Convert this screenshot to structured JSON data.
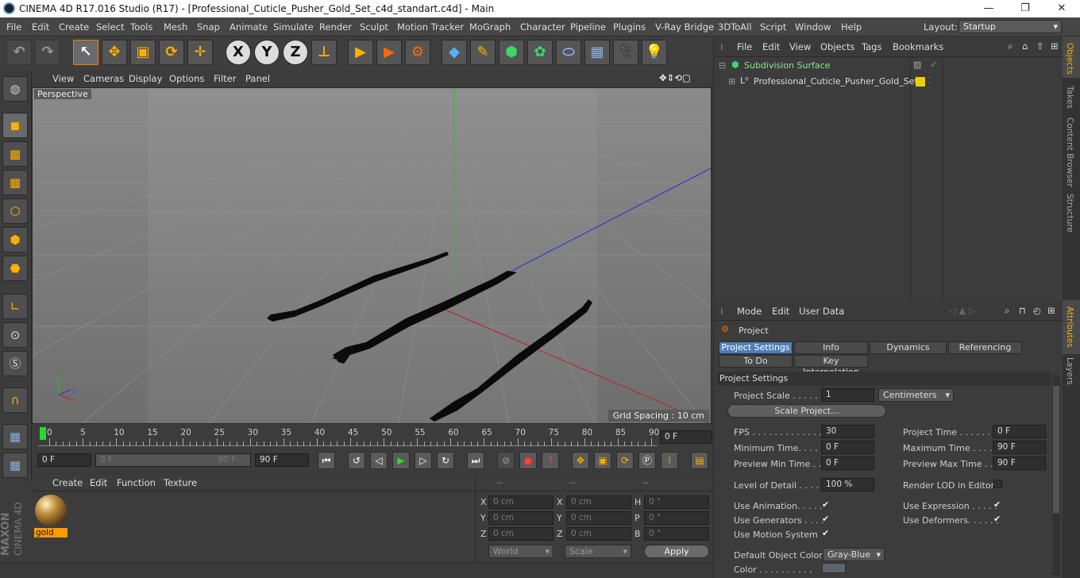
{
  "titlebar": {
    "title": "CINEMA 4D R17.016 Studio (R17) - [Professional_Cuticle_Pusher_Gold_Set_c4d_standart.c4d] - Main",
    "minimize": "—",
    "maximize": "❐",
    "close": "✕"
  },
  "menu": [
    "File",
    "Edit",
    "Create",
    "Select",
    "Tools",
    "Mesh",
    "Snap",
    "Animate",
    "Simulate",
    "Render",
    "Sculpt",
    "Motion Tracker",
    "MoGraph",
    "Character",
    "Pipeline",
    "Plugins",
    "V-Ray Bridge",
    "3DToAll",
    "Script",
    "Window",
    "Help"
  ],
  "layout": {
    "label": "Layout:",
    "value": "Startup"
  },
  "toolbar": {
    "x": "X",
    "y": "Y",
    "z": "Z"
  },
  "viewport": {
    "menu": [
      "View",
      "Cameras",
      "Display",
      "Options",
      "Filter",
      "Panel"
    ],
    "label": "Perspective",
    "grid_spacing": "Grid Spacing : 10 cm",
    "axis_labels": {
      "x": "X",
      "y": "Y",
      "z": "Z"
    }
  },
  "timeline": {
    "ticks": [
      "0",
      "5",
      "10",
      "15",
      "20",
      "25",
      "30",
      "35",
      "40",
      "45",
      "50",
      "55",
      "60",
      "65",
      "70",
      "75",
      "80",
      "85",
      "90"
    ],
    "current_frame": "0 F",
    "start": "0 F",
    "range_start": "0 F",
    "range_end": "90 F",
    "end": "90 F"
  },
  "material_panel": {
    "menu": [
      "Create",
      "Edit",
      "Function",
      "Texture"
    ],
    "materials": [
      {
        "name": "gold"
      }
    ]
  },
  "coords": {
    "headers": [
      "--",
      "--",
      "--"
    ],
    "rows": [
      {
        "a": "X",
        "av": "0 cm",
        "b": "X",
        "bv": "0 cm",
        "c": "H",
        "cv": "0 °"
      },
      {
        "a": "Y",
        "av": "0 cm",
        "b": "Y",
        "bv": "0 cm",
        "c": "P",
        "cv": "0 °"
      },
      {
        "a": "Z",
        "av": "0 cm",
        "b": "Z",
        "bv": "0 cm",
        "c": "B",
        "cv": "0 °"
      }
    ],
    "mode1": "World",
    "mode2": "Scale",
    "apply": "Apply"
  },
  "object_manager": {
    "menu": [
      "File",
      "Edit",
      "View",
      "Objects",
      "Tags",
      "Bookmarks"
    ],
    "objects": [
      {
        "name": "Subdivision Surface"
      },
      {
        "name": "Professional_Cuticle_Pusher_Gold_Set"
      }
    ]
  },
  "attributes": {
    "menu": [
      "Mode",
      "Edit",
      "User Data"
    ],
    "title": "Project",
    "tabs_row1": [
      "Project Settings",
      "Info",
      "Dynamics",
      "Referencing"
    ],
    "tabs_row2": [
      "To Do",
      "Key Interpolation"
    ],
    "section": "Project Settings",
    "project_scale_label": "Project Scale . . . . . .",
    "project_scale_value": "1",
    "project_scale_unit": "Centimeters",
    "scale_project_btn": "Scale Project...",
    "fps_label": "FPS . . . . . . . . . . . . . .",
    "fps": "30",
    "project_time_label": "Project Time . . . . . . .",
    "project_time": "0 F",
    "min_time_label": "Minimum Time. . . . . . .",
    "min_time": "0 F",
    "max_time_label": "Maximum Time . . . . . .",
    "max_time": "90 F",
    "prev_min_label": "Preview Min Time . . .",
    "prev_min": "0 F",
    "prev_max_label": "Preview Max Time . . .",
    "prev_max": "90 F",
    "lod_label": "Level of Detail . . . . .",
    "lod": "100 %",
    "render_lod_label": "Render LOD in Editor",
    "use_animation": "Use Animation. . . . .",
    "use_expression": "Use Expression . . . . .",
    "use_generators": "Use Generators . . . .",
    "use_deformers": "Use Deformers. . . . . .",
    "use_motion": "Use Motion System",
    "default_color_label": "Default Object Color",
    "default_color": "Gray-Blue",
    "color_label": "Color . . . . . . . . . ."
  },
  "right_tabs": [
    "Objects",
    "Takes",
    "Content Browser",
    "Structure",
    "Attributes",
    "Layers"
  ],
  "brand": {
    "maxon": "MAXON",
    "cinema": "CINEMA 4D"
  }
}
